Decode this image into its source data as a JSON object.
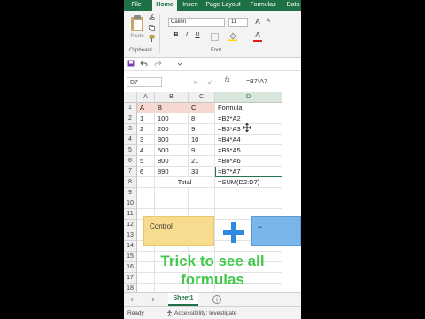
{
  "ribbon": {
    "tabs": [
      "File",
      "Home",
      "Insert",
      "Page Layout",
      "Formulas",
      "Data"
    ],
    "paste_label": "Paste",
    "clipboard_label": "Clipboard",
    "font_name": "Calibri",
    "font_size": "11",
    "font_label": "Font",
    "bold": "B",
    "italic": "I",
    "underline": "U",
    "grow_font": "A",
    "shrink_font": "A",
    "font_color": "A"
  },
  "formula_bar": {
    "name_box": "D7",
    "fx": "fx",
    "content": "=B7*A7"
  },
  "grid": {
    "columns": [
      "A",
      "B",
      "C",
      "D"
    ],
    "rows": [
      "1",
      "2",
      "3",
      "4",
      "5",
      "6",
      "7",
      "8",
      "9",
      "10",
      "11",
      "12",
      "13",
      "14",
      "15",
      "16",
      "17",
      "18",
      "19"
    ],
    "cells": [
      [
        "A",
        "B",
        "C",
        "Formula"
      ],
      [
        "1",
        "100",
        "8",
        "=B2*A2"
      ],
      [
        "2",
        "200",
        "9",
        "=B3*A3"
      ],
      [
        "3",
        "300",
        "10",
        "=B4*A4"
      ],
      [
        "4",
        "500",
        "9",
        "=B5*A5"
      ],
      [
        "5",
        "800",
        "21",
        "=B6*A6"
      ],
      [
        "6",
        "890",
        "33",
        "=B7*A7"
      ],
      [
        "",
        "Total",
        "",
        "=SUM(D2:D7)"
      ]
    ]
  },
  "overlay": {
    "ctrl_key": "Control",
    "tilde_key": "~",
    "caption_line1": "Trick to see all",
    "caption_line2": "formulas"
  },
  "sheets": {
    "active": "Sheet1",
    "add": "+"
  },
  "status": {
    "ready": "Ready",
    "accessibility": "Accessibility: Investigate"
  },
  "colors": {
    "excel_green": "#1e7145",
    "highlight": "#f6d8d0",
    "caption": "#43c84c",
    "ctrl_key": "#f7dc8f",
    "tilde_key": "#7bb6ea",
    "plus": "#2e8ae0"
  }
}
